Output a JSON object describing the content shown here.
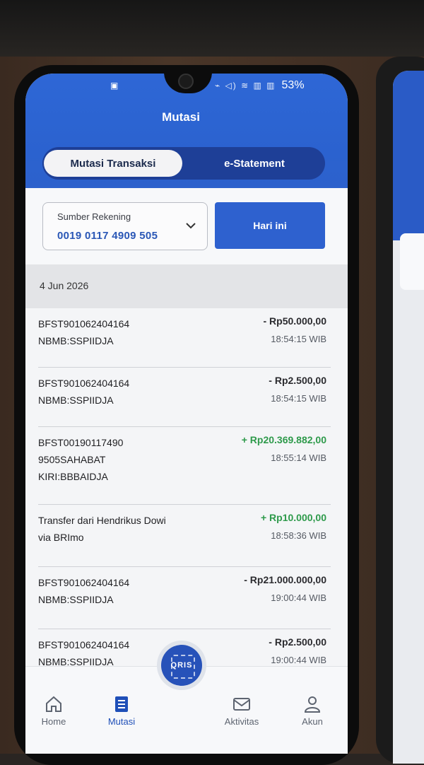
{
  "status_bar": {
    "left_icon": "sim-icon",
    "glyphs": "⌁ ◁) ≋ ▥ ▥",
    "battery": "53%"
  },
  "header": {
    "title": "Mutasi",
    "tabs": [
      {
        "label": "Mutasi Transaksi",
        "active": true
      },
      {
        "label": "e-Statement",
        "active": false
      }
    ]
  },
  "filter": {
    "source_label": "Sumber Rekening",
    "source_value": "0019 0117 4909 505",
    "period_button": "Hari ini"
  },
  "date_header": "4 Jun 2026",
  "transactions": [
    {
      "desc": "BFST901062404164\nNBMB:SSPIIDJA",
      "amount": "- Rp50.000,00",
      "type": "debit",
      "time": "18:54:15 WIB"
    },
    {
      "desc": "BFST901062404164\nNBMB:SSPIIDJA",
      "amount": "- Rp2.500,00",
      "type": "debit",
      "time": "18:54:15 WIB"
    },
    {
      "desc": "BFST00190117490\n9505SAHABAT\nKIRI:BBBAIDJA",
      "amount": "+ Rp20.369.882,00",
      "type": "credit",
      "time": "18:55:14 WIB"
    },
    {
      "desc": "Transfer dari Hendrikus Dowi\nvia BRImo",
      "amount": "+ Rp10.000,00",
      "type": "credit",
      "time": "18:58:36 WIB"
    },
    {
      "desc": "BFST901062404164\nNBMB:SSPIIDJA",
      "amount": "- Rp21.000.000,00",
      "type": "debit",
      "time": "19:00:44 WIB"
    },
    {
      "desc": "BFST901062404164\nNBMB:SSPIIDJA",
      "amount": "- Rp2.500,00",
      "type": "debit",
      "time": "19:00:44 WIB"
    }
  ],
  "bottom_nav": {
    "home": "Home",
    "mutasi": "Mutasi",
    "qris": "QRIS",
    "aktivitas": "Aktivitas",
    "akun": "Akun"
  },
  "colors": {
    "primary": "#2e61cf",
    "credit": "#2e9a4b",
    "debit": "#2b2b2f"
  }
}
